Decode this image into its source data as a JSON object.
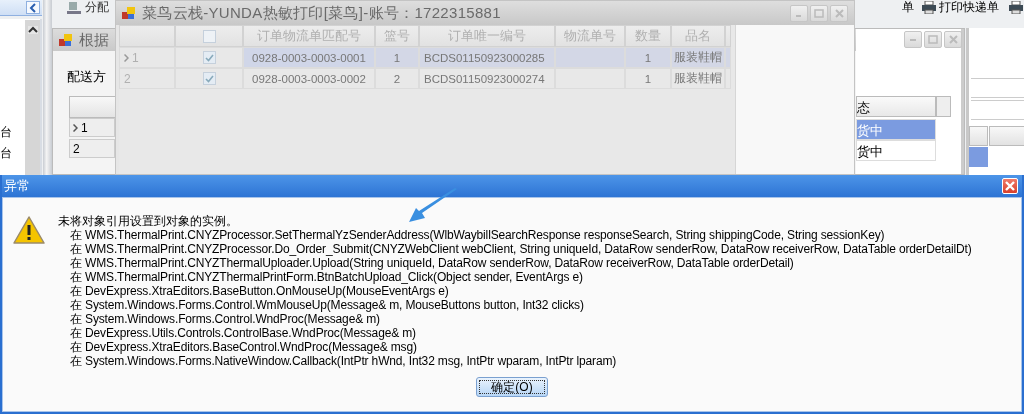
{
  "left_panel": {
    "items": [
      "台",
      "台"
    ]
  },
  "toolbar": [
    {
      "label": "分配",
      "kind": "assign"
    },
    {
      "label": "单",
      "kind": "cut"
    },
    {
      "label": "打印快递单",
      "kind": "print"
    }
  ],
  "back_window": {
    "title": "根据",
    "field_label": "配送方",
    "status_header": "态",
    "rows": [
      {
        "number": "1",
        "selected": true,
        "status": "货中"
      },
      {
        "number": "2",
        "selected": false,
        "status": "货中"
      }
    ]
  },
  "print_window": {
    "title": "菜鸟云栈-YUNDA热敏打印[菜鸟]-账号：1722315881",
    "header_checked": false,
    "columns": [
      "订单物流单匹配号",
      "篮号",
      "订单唯一编号",
      "物流单号",
      "数量",
      "品名"
    ],
    "rows": [
      {
        "number": "1",
        "selected": true,
        "checked": true,
        "match_no": "0928-0003-0003-0001",
        "basket_no": "1",
        "unique_no": "BCDS01150923000285",
        "qty": "1",
        "product": "服装鞋帽"
      },
      {
        "number": "2",
        "selected": false,
        "checked": true,
        "match_no": "0928-0003-0003-0002",
        "basket_no": "2",
        "unique_no": "BCDS01150923000274",
        "qty": "1",
        "product": "服装鞋帽"
      }
    ]
  },
  "dialog": {
    "title": "异常",
    "message": "未将对象引用设置到对象的实例。",
    "stack": [
      "在 WMS.ThermalPrint.CNYZProcessor.SetThermalYzSenderAddress(WlbWaybillSearchResponse responseSearch, String shippingCode, String sessionKey)",
      "在 WMS.ThermalPrint.CNYZProcessor.Do_Order_Submit(CNYZWebClient webClient, String uniqueId, DataRow senderRow, DataRow receiverRow, DataTable orderDetailDt)",
      "在 WMS.ThermalPrint.CNYZThermalUploader.Upload(String uniqueId, DataRow senderRow, DataRow receiverRow, DataTable orderDetail)",
      "在 WMS.ThermalPrint.CNYZThermalPrintForm.BtnBatchUpload_Click(Object sender, EventArgs e)",
      "在 DevExpress.XtraEditors.BaseButton.OnMouseUp(MouseEventArgs e)",
      "在 System.Windows.Forms.Control.WmMouseUp(Message& m, MouseButtons button, Int32 clicks)",
      "在 System.Windows.Forms.Control.WndProc(Message& m)",
      "在 DevExpress.Utils.Controls.ControlBase.WndProc(Message& m)",
      "在 DevExpress.XtraEditors.BaseControl.WndProc(Message& msg)",
      "在 System.Windows.Forms.NativeWindow.Callback(IntPtr hWnd, Int32 msg, IntPtr wparam, IntPtr lparam)"
    ],
    "ok_button": "确定(O)"
  }
}
